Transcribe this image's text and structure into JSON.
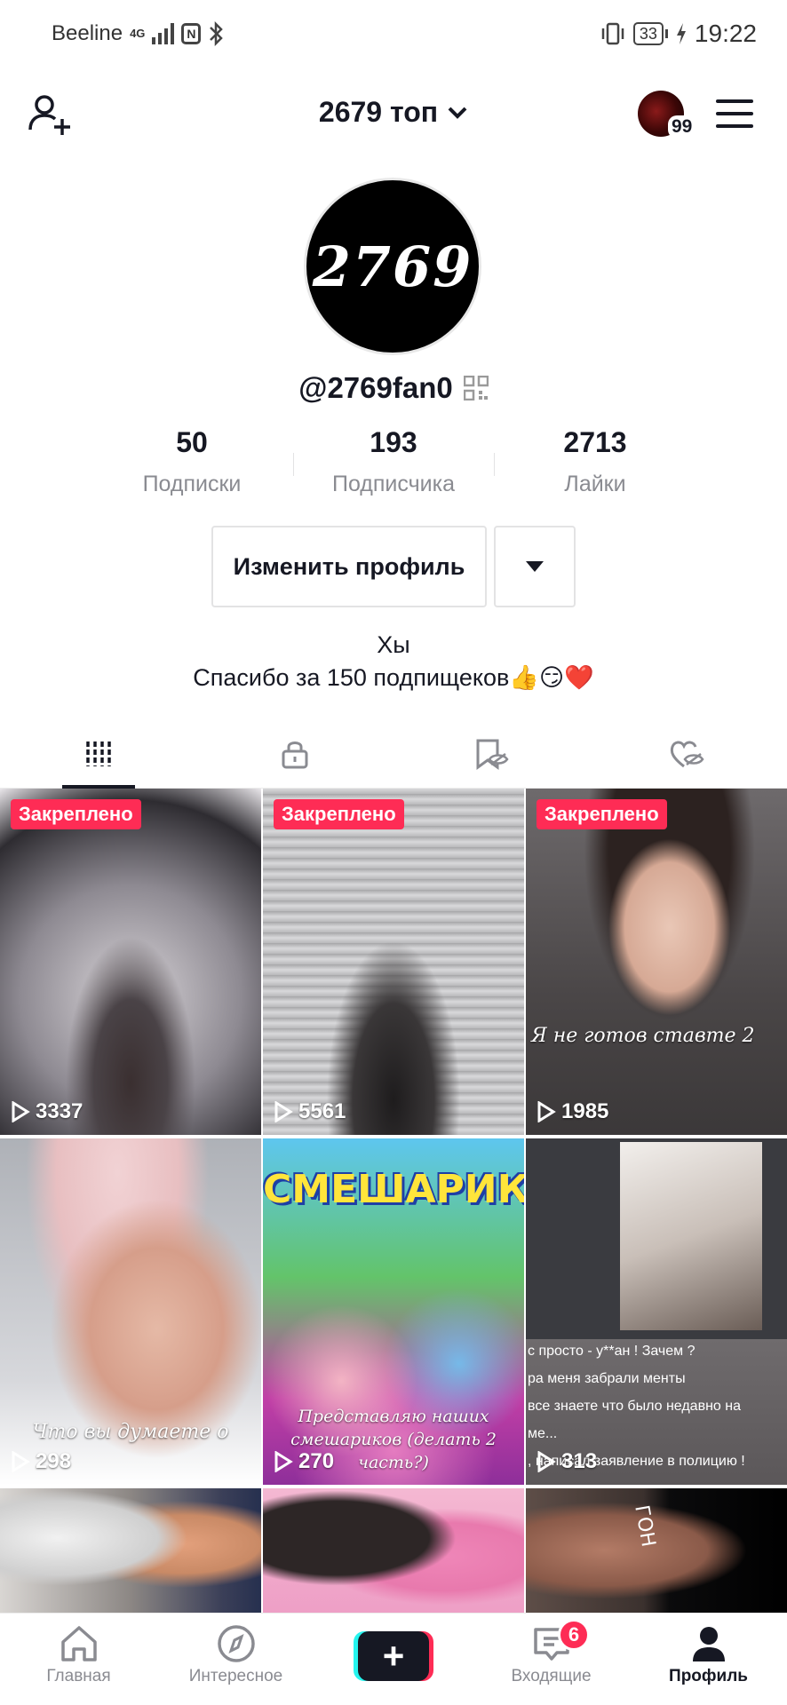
{
  "status_bar": {
    "carrier": "Beeline",
    "network": "4G",
    "battery": "33",
    "time": "19:22"
  },
  "header": {
    "account_title": "2679 топ",
    "avatar_badge": "99"
  },
  "profile": {
    "avatar_text": "2769",
    "username": "@2769fan0",
    "stats": [
      {
        "value": "50",
        "label": "Подписки"
      },
      {
        "value": "193",
        "label": "Подписчика"
      },
      {
        "value": "2713",
        "label": "Лайки"
      }
    ],
    "edit_button": "Изменить профиль",
    "bio_line1": "Хы",
    "bio_line2": "Спасибо за 150 подпищеков",
    "bio_emoji": "👍😏❤️"
  },
  "tabs": [
    {
      "icon": "grid-icon",
      "active": true
    },
    {
      "icon": "lock-icon",
      "active": false
    },
    {
      "icon": "bookmark-eye-icon",
      "active": false
    },
    {
      "icon": "heart-eye-icon",
      "active": false
    }
  ],
  "grid": {
    "pinned_label": "Закреплено",
    "tiles": [
      {
        "views": "3337",
        "pinned": true,
        "caption": ""
      },
      {
        "views": "5561",
        "pinned": true,
        "caption": ""
      },
      {
        "views": "1985",
        "pinned": true,
        "caption": "Я не готов ставте 2"
      },
      {
        "views": "298",
        "pinned": false,
        "caption": "Что вы думаете о"
      },
      {
        "views": "270",
        "pinned": false,
        "caption": "Представляю наших смешариков (делать 2 часть?)",
        "title_art": "СМЕШАРИКИ"
      },
      {
        "views": "313",
        "pinned": false,
        "caption": "",
        "chat_lines": [
          "с просто - у**ан ! Зачем ?",
          "ра меня забрали менты",
          "все знаете что было недавно на",
          "ме...",
          ", написал заявление в полицию !"
        ]
      },
      {
        "views": "",
        "pinned": false,
        "caption": ""
      },
      {
        "views": "",
        "pinned": false,
        "caption": ""
      },
      {
        "views": "",
        "pinned": false,
        "caption": "",
        "side_text": "ГОН"
      }
    ]
  },
  "bottom_nav": {
    "items": [
      {
        "label": "Главная",
        "icon": "home-icon"
      },
      {
        "label": "Интересное",
        "icon": "compass-icon"
      },
      {
        "label": "",
        "icon": "plus-icon"
      },
      {
        "label": "Входящие",
        "icon": "inbox-icon"
      },
      {
        "label": "Профиль",
        "icon": "profile-icon"
      }
    ],
    "inbox_badge": "6"
  },
  "colors": {
    "accent": "#fe2c55",
    "cyan": "#25f4ee",
    "text_primary": "#161823",
    "text_secondary": "#8a8b91"
  }
}
